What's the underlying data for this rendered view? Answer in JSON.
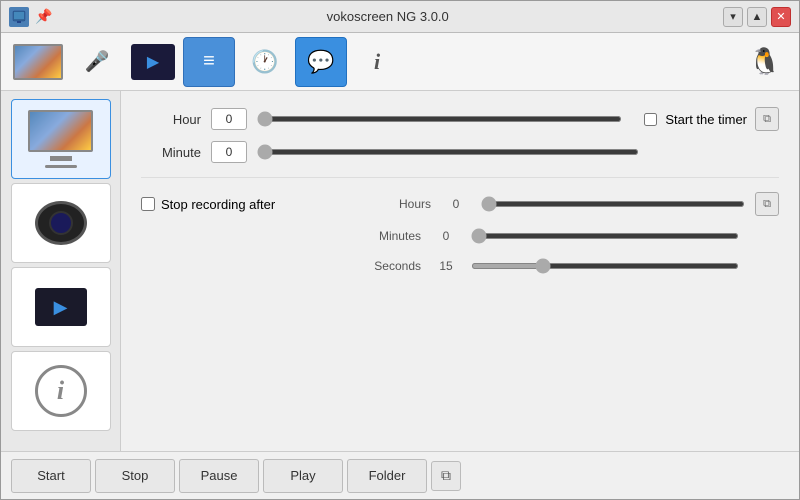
{
  "window": {
    "title": "vokoscreen NG 3.0.0",
    "controls": {
      "dropdown": "▾",
      "minimize": "▲",
      "close": "✕"
    }
  },
  "toolbar": {
    "buttons": [
      {
        "id": "screen",
        "icon": "🖥",
        "label": "Screen",
        "active": false
      },
      {
        "id": "audio",
        "icon": "🎤",
        "label": "Audio",
        "active": false
      },
      {
        "id": "video",
        "icon": "▶",
        "label": "Video",
        "active": false
      },
      {
        "id": "settings",
        "icon": "⚙",
        "label": "Settings",
        "active": false
      },
      {
        "id": "timer",
        "icon": "🕐",
        "label": "Timer",
        "active": false
      },
      {
        "id": "chat",
        "icon": "💬",
        "label": "Chat",
        "active": true
      },
      {
        "id": "info",
        "icon": "ℹ",
        "label": "Info",
        "active": false
      }
    ]
  },
  "sidebar": {
    "items": [
      {
        "id": "screen",
        "label": "Screen"
      },
      {
        "id": "camera",
        "label": "Camera"
      },
      {
        "id": "player",
        "label": "Player"
      },
      {
        "id": "info",
        "label": "Info"
      }
    ]
  },
  "content": {
    "hour_label": "Hour",
    "hour_value": "0",
    "hour_max": 23,
    "hour_current": 0,
    "minute_label": "Minute",
    "minute_value": "0",
    "minute_max": 59,
    "minute_current": 0,
    "start_timer_label": "Start the timer",
    "stop_recording_label": "Stop recording after",
    "stop_recording_checked": false,
    "sub_rows": [
      {
        "id": "hours",
        "label": "Hours",
        "value": "0",
        "current": 0,
        "max": 23
      },
      {
        "id": "minutes",
        "label": "Minutes",
        "value": "0",
        "current": 0,
        "max": 59
      },
      {
        "id": "seconds",
        "label": "Seconds",
        "value": "15",
        "current": 15,
        "max": 59
      }
    ]
  },
  "bottombar": {
    "start": "Start",
    "stop": "Stop",
    "pause": "Pause",
    "play": "Play",
    "folder": "Folder"
  },
  "linux_icon": "🐧"
}
